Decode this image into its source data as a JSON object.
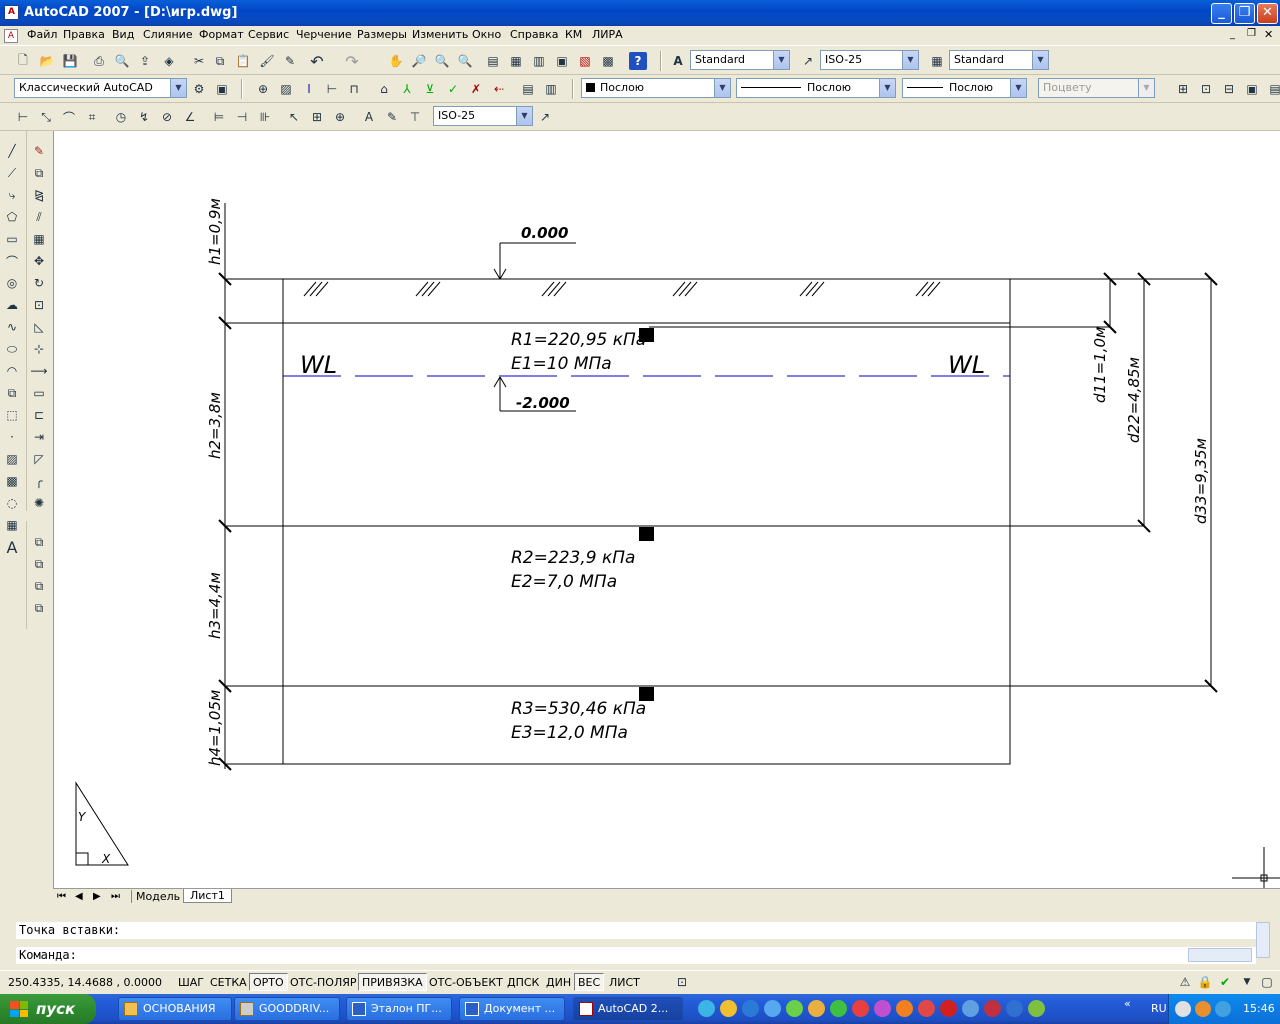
{
  "window": {
    "title": "AutoCAD 2007 - [D:\\игр.dwg]"
  },
  "menu": [
    "Файл",
    "Правка",
    "Вид",
    "Слияние",
    "Формат",
    "Сервис",
    "Черчение",
    "Размеры",
    "Изменить",
    "Окно",
    "Справка",
    "КМ",
    "ЛИРА"
  ],
  "toolbar_styles": {
    "text_style": "Standard",
    "dim_style": "ISO-25",
    "table_style": "Standard"
  },
  "toolbar_layers": {
    "workspace": "Классический AutoCAD",
    "color": "Послою",
    "linetype": "Послою",
    "lineweight": "Послою",
    "plotstyle": "Поцвету"
  },
  "toolbar_dims": {
    "dim_style": "ISO-25"
  },
  "drawing": {
    "level_top": "0.000",
    "level_water": "-2.000",
    "wl_left": "WL",
    "wl_right": "WL",
    "layer1_r": "R1=220,95 кПа",
    "layer1_e": "E1=10 МПа",
    "layer2_r": "R2=223,9 кПа",
    "layer2_e": "E2=7,0 МПа",
    "layer3_r": "R3=530,46 кПа",
    "layer3_e": "E3=12,0 МПа",
    "h1": "h1=0,9м",
    "h2": "h2=3,8м",
    "h3": "h3=4,4м",
    "h4": "h4=1,05м",
    "d11": "d11=1,0м",
    "d22": "d22=4,85м",
    "d33": "d33=9,35м",
    "ucs_y": "Y",
    "ucs_x": "X"
  },
  "tabs": {
    "model": "Модель",
    "layout": "Лист1"
  },
  "command": {
    "line1": "Точка вставки:",
    "line2": "Команда:"
  },
  "status": {
    "coords": "250.4335, 14.4688 , 0.0000",
    "buttons": [
      {
        "label": "ШАГ",
        "on": false
      },
      {
        "label": "СЕТКА",
        "on": false
      },
      {
        "label": "ОРТО",
        "on": true
      },
      {
        "label": "ОТС-ПОЛЯР",
        "on": false
      },
      {
        "label": "ПРИВЯЗКА",
        "on": true
      },
      {
        "label": "ОТС-ОБЪЕКТ",
        "on": false
      },
      {
        "label": "ДПСК",
        "on": false
      },
      {
        "label": "ДИН",
        "on": false
      },
      {
        "label": "ВЕС",
        "on": true
      },
      {
        "label": "ЛИСТ",
        "on": false
      }
    ]
  },
  "taskbar": {
    "start": "пуск",
    "tasks": [
      "ОСНОВАНИЯ",
      "GOODDRIV...",
      "Эталон ПГ...",
      "Документ ...",
      "AutoCAD 2..."
    ],
    "lang": "RU",
    "clock": "15:46"
  },
  "colors": {
    "accent": "#0A5FD8",
    "water_line": "#0000C8",
    "canvas": "#FFFFFF"
  }
}
